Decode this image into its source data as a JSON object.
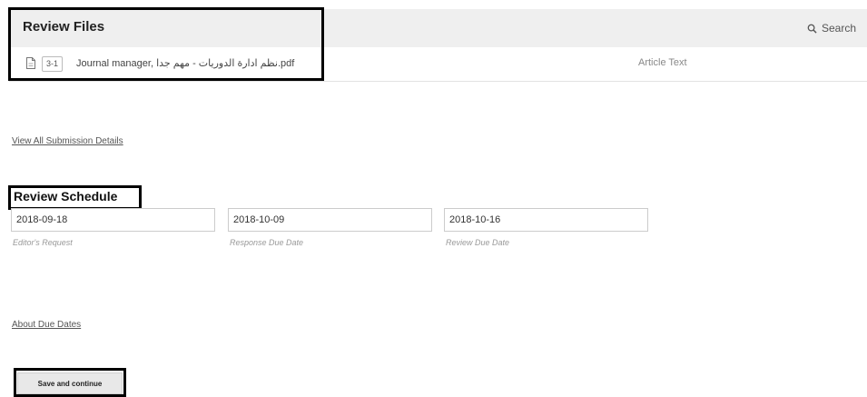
{
  "review_files": {
    "title": "Review Files",
    "search_label": "Search",
    "search_icon": "search-icon",
    "files": [
      {
        "icon": "document-icon",
        "id": "3-1",
        "name": "Journal manager, نظم ادارة الدوريات - مهم جدا.pdf",
        "genre": "Article Text"
      }
    ]
  },
  "submission": {
    "view_details_link": "View All Submission Details"
  },
  "review_schedule": {
    "title": "Review Schedule",
    "fields": [
      {
        "value": "2018-09-18",
        "label": "Editor's Request"
      },
      {
        "value": "2018-10-09",
        "label": "Response Due Date"
      },
      {
        "value": "2018-10-16",
        "label": "Review Due Date"
      }
    ],
    "about_link": "About Due Dates"
  },
  "actions": {
    "save_label": "Save and continue"
  },
  "highlight_color": "#000000"
}
